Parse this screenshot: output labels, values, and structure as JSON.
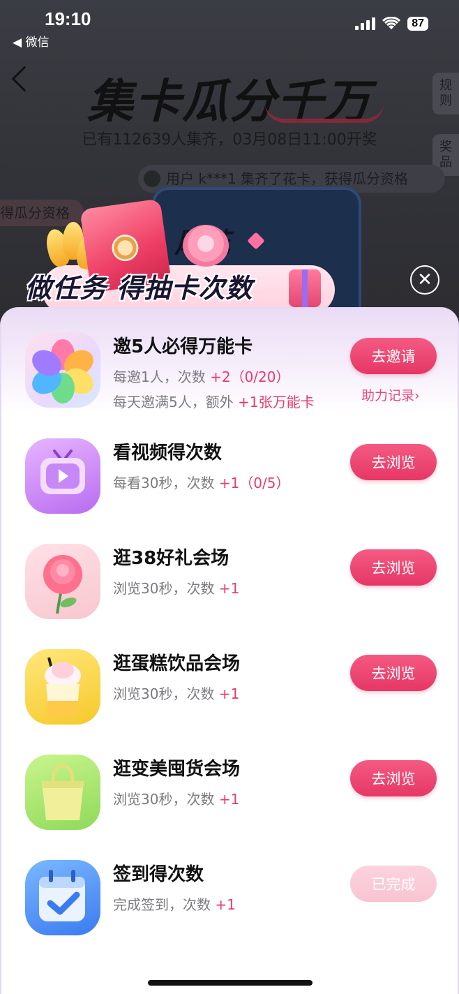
{
  "status_bar": {
    "time": "19:10",
    "back_app": "◀ 微信",
    "battery": "87"
  },
  "background_page": {
    "title": "集卡瓜分千万",
    "subtitle": "已有112639人集齐，03月08日11:00开奖",
    "side_tabs": [
      "规则",
      "奖品"
    ],
    "ticker": "用户 k***1 集齐了花卡，获得瓜分资格",
    "left_chip": "得瓜分资格",
    "card_title": "尾花"
  },
  "popup": {
    "heading": "做任务 得抽卡次数",
    "close_icon": "close-icon",
    "tasks": [
      {
        "icon": "flower-icon",
        "title": "邀5人必得万能卡",
        "desc_prefix": "每邀1人，次数 ",
        "desc_highlight": "+2（0/20）",
        "desc2_prefix": "每天邀满5人，额外 ",
        "desc2_highlight": "+1张万能卡",
        "button": "去邀请",
        "help_link": "助力记录›"
      },
      {
        "icon": "tv-icon",
        "title": "看视频得次数",
        "desc_prefix": "每看30秒，次数 ",
        "desc_highlight": "+1（0/5）",
        "button": "去浏览"
      },
      {
        "icon": "rose-icon",
        "title": "逛38好礼会场",
        "desc_prefix": "浏览30秒，次数 ",
        "desc_highlight": "+1",
        "button": "去浏览"
      },
      {
        "icon": "cake-drink-icon",
        "title": "逛蛋糕饮品会场",
        "desc_prefix": "浏览30秒，次数 ",
        "desc_highlight": "+1",
        "button": "去浏览"
      },
      {
        "icon": "bag-icon",
        "title": "逛变美囤货会场",
        "desc_prefix": "浏览30秒，次数 ",
        "desc_highlight": "+1",
        "button": "去浏览"
      },
      {
        "icon": "calendar-check-icon",
        "title": "签到得次数",
        "desc_prefix": "完成签到，次数 ",
        "desc_highlight": "+1",
        "button": "已完成",
        "completed": true
      }
    ]
  },
  "colors": {
    "accent": "#e63765",
    "highlight_text": "#ea3a6b",
    "done_button": "#f9c4d2"
  }
}
